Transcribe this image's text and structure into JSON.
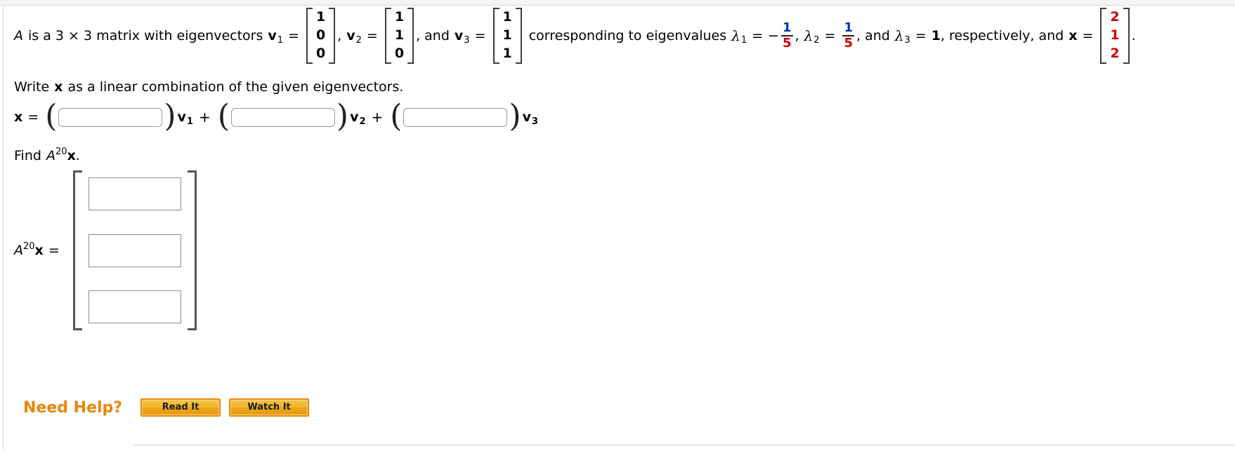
{
  "problem": {
    "intro_a": "A",
    "intro_text1": "is a 3 × 3 matrix with eigenvectors",
    "v1_label": "v",
    "v1_sub": "1",
    "v2_label": "v",
    "v2_sub": "2",
    "v3_label": "v",
    "v3_sub": "3",
    "and_text": ", and",
    "comma": ",",
    "equals": "=",
    "corresponding_text": "corresponding to eigenvalues",
    "lambda": "λ",
    "lam1_sub": "1",
    "lam2_sub": "2",
    "lam3_sub": "3",
    "minus_sign": "−",
    "frac1_num": "1",
    "frac1_den": "5",
    "frac2_num": "1",
    "frac2_den": "5",
    "lam3_value": "1",
    "and_lambda3": ", and",
    "respectively_text": ", respectively, and",
    "x_label": "x",
    "period": ".",
    "vectors": {
      "v1": [
        "1",
        "0",
        "0"
      ],
      "v2": [
        "1",
        "1",
        "0"
      ],
      "v3": [
        "1",
        "1",
        "1"
      ],
      "x": [
        "2",
        "1",
        "2"
      ]
    }
  },
  "part_a": {
    "instruction": "Write x as a linear combination of the given eigenvectors.",
    "instruction_pre": "Write",
    "instruction_x": "x",
    "instruction_post": "as a linear combination of the given eigenvectors.",
    "x_label": "x",
    "equals": "=",
    "plus": "+",
    "open_paren": "(",
    "close_paren": ")",
    "coef1_value": "",
    "coef2_value": "",
    "coef3_value": "",
    "coef1_placeholder": "",
    "coef2_placeholder": "",
    "coef3_placeholder": "",
    "v_label": "v",
    "v1_sub": "1",
    "v2_sub": "2",
    "v3_sub": "3"
  },
  "part_b": {
    "instruction_pre": "Find",
    "instruction_A": "A",
    "instruction_exp": "20",
    "instruction_x": "x",
    "instruction_period": ".",
    "label_A": "A",
    "label_exp": "20",
    "label_x": "x",
    "label_equals": "=",
    "entry1_value": "",
    "entry2_value": "",
    "entry3_value": "",
    "entry1_placeholder": "",
    "entry2_placeholder": "",
    "entry3_placeholder": ""
  },
  "need_help": {
    "label": "Need Help?",
    "read_it": "Read It",
    "watch_it": "Watch It"
  },
  "colors": {
    "red_value": "#cc0000",
    "blue_value": "#0033aa",
    "help_orange": "#e8860d",
    "button_gold": "#efb42c"
  }
}
